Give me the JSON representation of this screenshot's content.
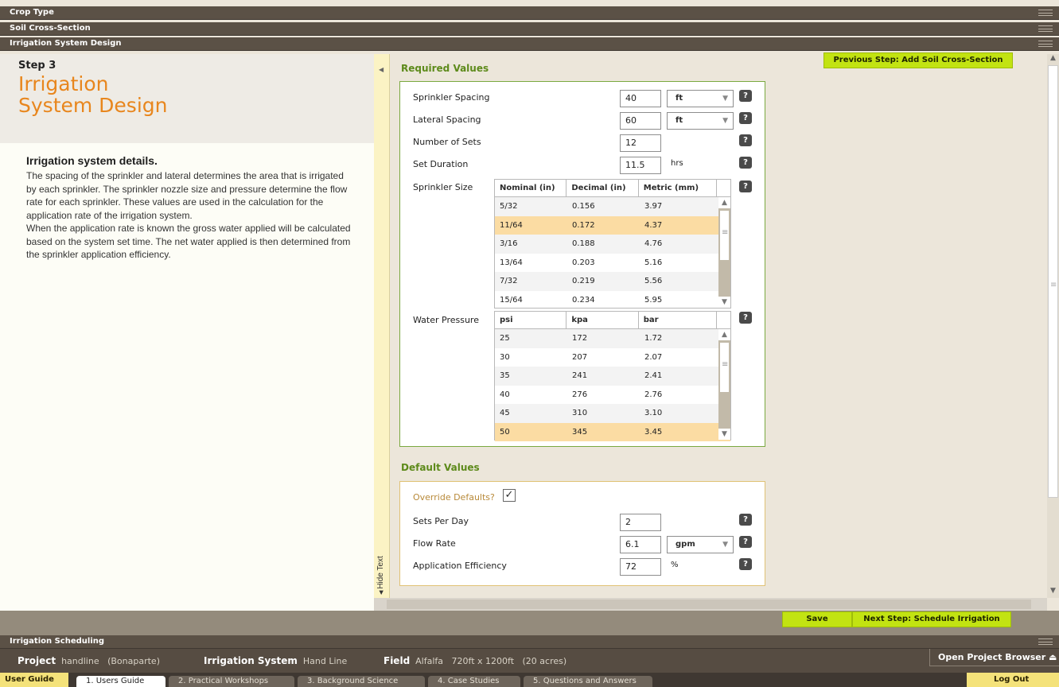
{
  "accordions": {
    "crop_type": "Crop Type",
    "soil_cross_section": "Soil Cross-Section",
    "irrigation_system_design": "Irrigation System Design",
    "irrigation_scheduling": "Irrigation Scheduling"
  },
  "left_panel": {
    "step_label": "Step 3",
    "step_title": "Irrigation System Design",
    "details_heading": "Irrigation system details.",
    "paragraph_1": "The spacing of the sprinkler and lateral determines the area that is irrigated by each sprinkler. The sprinkler nozzle size and pressure determine the flow rate for each sprinkler. These values are used in the calculation for the application rate of the irrigation system.",
    "paragraph_2": "When the application rate is known the gross water applied will be calculated based on the system set time. The net water applied is then determined from the sprinkler application efficiency."
  },
  "hide_text": "Hide Text",
  "buttons": {
    "previous_step": "Previous Step: Add Soil Cross-Section",
    "save": "Save",
    "next_step": "Next Step: Schedule Irrigation"
  },
  "required": {
    "heading": "Required Values",
    "sprinkler_spacing": {
      "label": "Sprinkler Spacing",
      "value": "40",
      "unit": "ft"
    },
    "lateral_spacing": {
      "label": "Lateral Spacing",
      "value": "60",
      "unit": "ft"
    },
    "number_of_sets": {
      "label": "Number of Sets",
      "value": "12"
    },
    "set_duration": {
      "label": "Set Duration",
      "value": "11.5",
      "unit": "hrs"
    },
    "sprinkler_size": {
      "label": "Sprinkler Size",
      "columns": [
        "Nominal (in)",
        "Decimal (in)",
        "Metric (mm)"
      ],
      "rows": [
        [
          "5/32",
          "0.156",
          "3.97"
        ],
        [
          "11/64",
          "0.172",
          "4.37"
        ],
        [
          "3/16",
          "0.188",
          "4.76"
        ],
        [
          "13/64",
          "0.203",
          "5.16"
        ],
        [
          "7/32",
          "0.219",
          "5.56"
        ],
        [
          "15/64",
          "0.234",
          "5.95"
        ]
      ],
      "selected_row": 1
    },
    "water_pressure": {
      "label": "Water Pressure",
      "columns": [
        "psi",
        "kpa",
        "bar"
      ],
      "rows": [
        [
          "25",
          "172",
          "1.72"
        ],
        [
          "30",
          "207",
          "2.07"
        ],
        [
          "35",
          "241",
          "2.41"
        ],
        [
          "40",
          "276",
          "2.76"
        ],
        [
          "45",
          "310",
          "3.10"
        ],
        [
          "50",
          "345",
          "3.45"
        ]
      ],
      "selected_row": 5
    }
  },
  "defaults": {
    "heading": "Default Values",
    "override_label": "Override Defaults?",
    "override_checked": true,
    "sets_per_day": {
      "label": "Sets Per Day",
      "value": "2"
    },
    "flow_rate": {
      "label": "Flow Rate",
      "value": "6.1",
      "unit": "gpm"
    },
    "application_efficiency": {
      "label": "Application Efficiency",
      "value": "72",
      "unit": "%"
    }
  },
  "help_glyph": "?",
  "project_bar": {
    "project_label": "Project",
    "project_name": "handline",
    "project_location": "(Bonaparte)",
    "system_label": "Irrigation System",
    "system_value": "Hand Line",
    "field_label": "Field",
    "field_crop": "Alfalfa",
    "field_size": "720ft x 1200ft",
    "field_acres": "(20 acres)",
    "open_browser": "Open Project Browser"
  },
  "tab_bar": {
    "user_guide": "User Guide",
    "tabs": [
      "1. Users Guide",
      "2. Practical Workshops",
      "3. Background Science",
      "4. Case Studies",
      "5. Questions and Answers"
    ],
    "active_tab": 0,
    "logout": "Log Out"
  },
  "colors": {
    "accent_orange": "#e8861d",
    "accent_green": "#5d8a1a",
    "lime_button": "#c2e312",
    "selected_row": "#fbdca3"
  }
}
